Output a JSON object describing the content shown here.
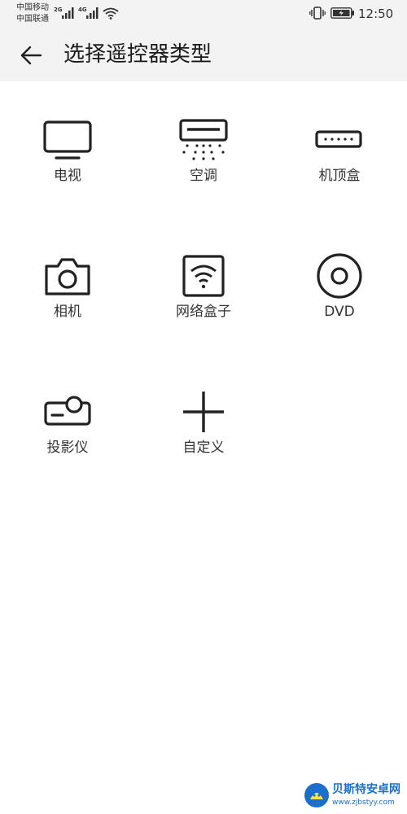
{
  "status_bar": {
    "carrier_1": "中国移动",
    "carrier_2": "中国联通",
    "signal_1_type": "2G",
    "signal_2_type": "4G",
    "time": "12:50",
    "icons": [
      "signal-icon",
      "wifi-icon",
      "vibrate-icon",
      "battery-charging-icon"
    ]
  },
  "header": {
    "title": "选择遥控器类型",
    "back_icon": "arrow-left-icon"
  },
  "devices": [
    {
      "label": "电视",
      "icon": "tv-icon"
    },
    {
      "label": "空调",
      "icon": "air-conditioner-icon"
    },
    {
      "label": "机顶盒",
      "icon": "set-top-box-icon"
    },
    {
      "label": "相机",
      "icon": "camera-icon"
    },
    {
      "label": "网络盒子",
      "icon": "network-box-icon"
    },
    {
      "label": "DVD",
      "icon": "dvd-icon"
    },
    {
      "label": "投影仪",
      "icon": "projector-icon"
    },
    {
      "label": "自定义",
      "icon": "plus-icon"
    }
  ],
  "watermark": {
    "name": "贝斯特安卓网",
    "url": "www.zjbstyy.com"
  },
  "colors": {
    "header_bg": "#f3f3f3",
    "icon_stroke": "#222222",
    "text": "#333333",
    "watermark": "#1b6fc9"
  }
}
